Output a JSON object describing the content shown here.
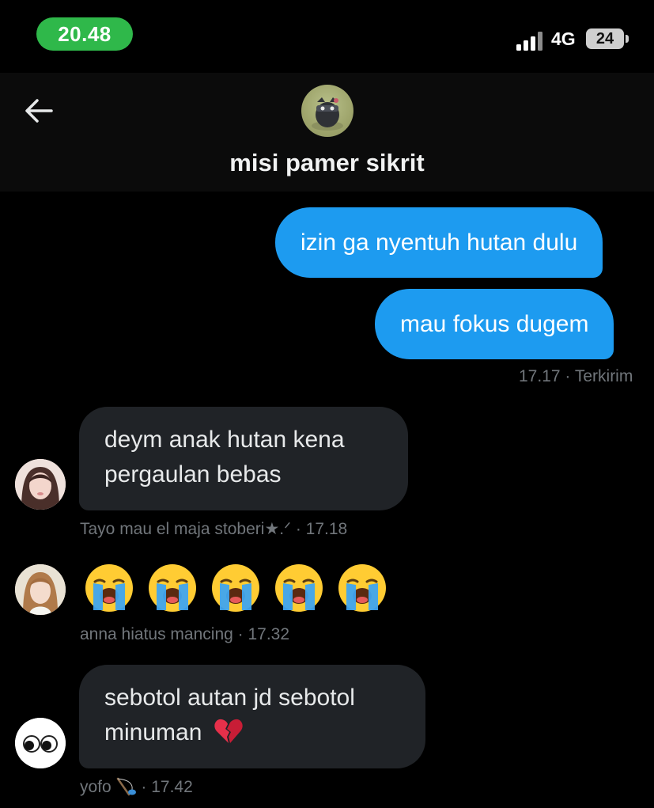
{
  "status_bar": {
    "time": "20.48",
    "network": "4G",
    "battery": "24"
  },
  "header": {
    "title": "misi pamer sikrit",
    "back_icon": "arrow-left-icon"
  },
  "messages": [
    {
      "direction": "out",
      "text": "izin ga nyentuh hutan dulu"
    },
    {
      "direction": "out",
      "text": "mau fokus dugem"
    },
    {
      "direction": "out",
      "meta_time": "17.17",
      "meta_status": "· Terkirim"
    },
    {
      "direction": "in",
      "text_line1": "deym anak hutan kena",
      "text_line2": "pergaulan bebas",
      "sender": "Tayo mau el maja stoberi★.ᐟ",
      "time": "· 17.18"
    },
    {
      "direction": "in",
      "emoji": "loudly-crying-face",
      "emoji_count": 5,
      "sender": "anna hiatus mancing",
      "time": "· 17.32"
    },
    {
      "direction": "in",
      "text_line1": "sebotol autan jd sebotol",
      "text_line2": "minuman",
      "text_emoji": "broken-heart",
      "sender": "yofo",
      "sender_emoji": "fishing-pole",
      "time": "· 17.42"
    }
  ],
  "colors": {
    "background": "#000000",
    "outgoing_bubble": "#1d9bf0",
    "incoming_bubble": "#202327",
    "meta_text": "#71767b",
    "time_pill": "#2fb84a"
  }
}
